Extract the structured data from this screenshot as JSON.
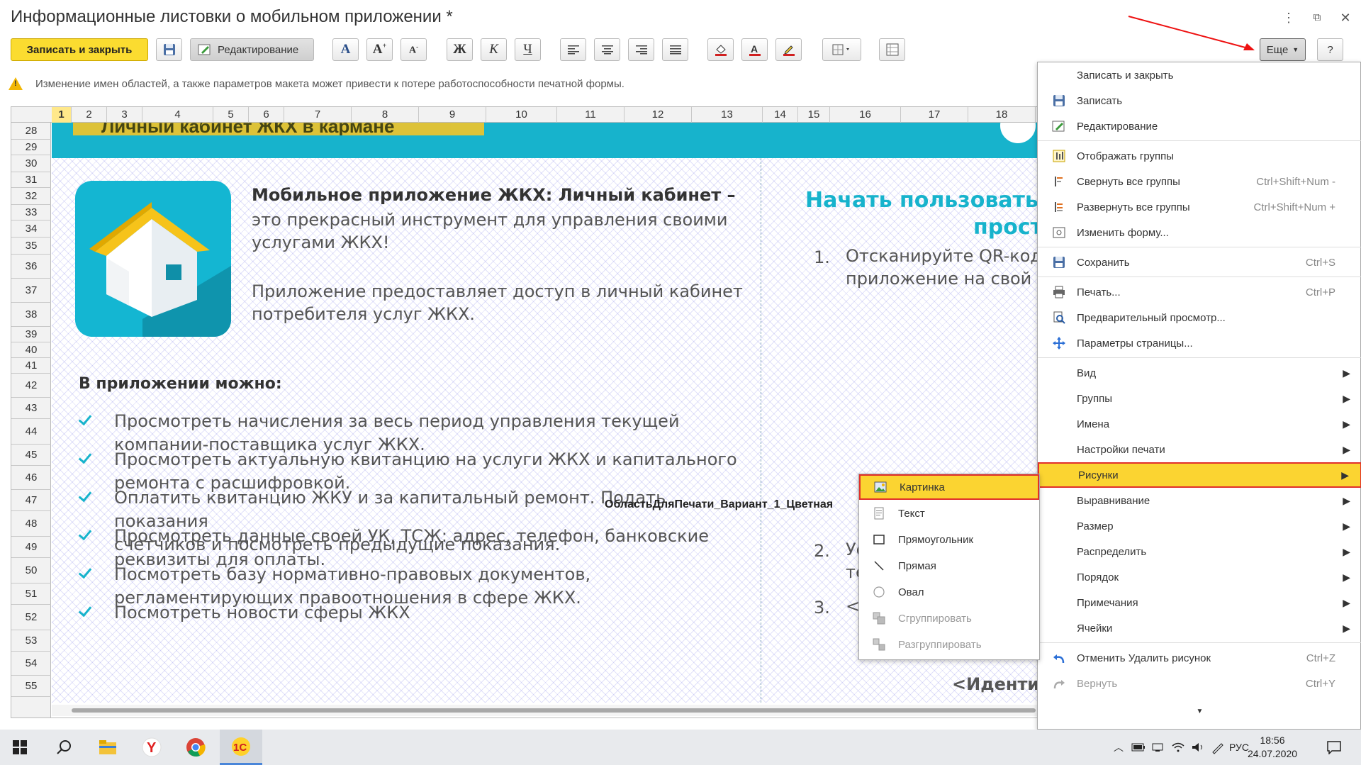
{
  "window": {
    "title": "Информационные листовки о мобильном приложении *"
  },
  "toolbar": {
    "save_close_label": "Записать и закрыть",
    "editing_label": "Редактирование",
    "bold_label": "Ж",
    "italic_label": "К",
    "underline_label": "Ч",
    "more_label": "Еще",
    "help_label": "?"
  },
  "warning": {
    "text": "Изменение имен областей, а также параметров макета может привести к потере работоспособности печатной формы."
  },
  "sheet": {
    "columns": [
      "1",
      "2",
      "3",
      "4",
      "5",
      "6",
      "7",
      "8",
      "9",
      "10",
      "11",
      "12",
      "13",
      "14",
      "15",
      "16",
      "17",
      "18"
    ],
    "rows": [
      "28",
      "29",
      "30",
      "31",
      "32",
      "33",
      "34",
      "35",
      "36",
      "37",
      "38",
      "39",
      "40",
      "41",
      "42",
      "43",
      "44",
      "45",
      "46",
      "47",
      "48",
      "49",
      "50",
      "51",
      "52",
      "53",
      "54",
      "55"
    ]
  },
  "layout": {
    "banner_label": "Личный кабинет ЖКХ в кармане",
    "intro_title": "Мобильное приложение ЖКХ: Личный кабинет –",
    "intro_lines": [
      "это прекрасный инструмент для управления своими",
      "услугами ЖКХ!"
    ],
    "intro_desc_lines": [
      "Приложение предоставляет доступ в личный кабинет",
      "потребителя услуг ЖКХ."
    ],
    "features_title": "В приложении можно:",
    "features": [
      [
        "Просмотреть начисления за весь период управления текущей",
        "компании-поставщика услуг ЖКХ."
      ],
      [
        "Просмотреть актуальную квитанцию на услуги ЖКХ и капитального",
        "ремонта с расшифровкой."
      ],
      [
        "Оплатить квитанцию ЖКУ и за капитальный ремонт. Подать показания",
        "счетчиков и посмотреть предыдущие показания."
      ],
      [
        "Просмотреть данные своей УК, ТСЖ: адрес, телефон, банковские",
        "реквизиты для оплаты."
      ],
      [
        "Посмотреть базу нормативно-правовых документов,",
        "регламентирующих правоотношения в сфере ЖКХ."
      ],
      [
        "Посмотреть новости сферы ЖКХ"
      ]
    ],
    "area_name": "ОбластьДляПечати_Вариант_1_Цветная",
    "right_title_1": "Начать пользоваться",
    "right_title_2": "прост",
    "steps": [
      {
        "num": "1.",
        "lines": [
          "Отсканируйте QR-код,",
          "приложение на свой м"
        ]
      },
      {
        "num": "2.",
        "lines": [
          "Ус",
          "те"
        ]
      },
      {
        "num": "3.",
        "lines": [
          "<Те"
        ]
      }
    ],
    "identifier": "<Идентиф"
  },
  "menu": {
    "items": [
      {
        "label": "Записать и закрыть",
        "shortcut": "",
        "icon": "none",
        "submenu": false
      },
      {
        "label": "Записать",
        "shortcut": "",
        "icon": "floppy-icon",
        "submenu": false
      },
      {
        "label": "Редактирование",
        "shortcut": "",
        "icon": "edit-icon",
        "submenu": false
      },
      {
        "label": "Отображать группы",
        "shortcut": "",
        "icon": "groups-icon",
        "submenu": false
      },
      {
        "label": "Свернуть все группы",
        "shortcut": "Ctrl+Shift+Num -",
        "icon": "collapse-icon",
        "submenu": false
      },
      {
        "label": "Развернуть все группы",
        "shortcut": "Ctrl+Shift+Num +",
        "icon": "expand-icon",
        "submenu": false
      },
      {
        "label": "Изменить форму...",
        "shortcut": "",
        "icon": "form-icon",
        "submenu": false
      },
      {
        "label": "Сохранить",
        "shortcut": "Ctrl+S",
        "icon": "floppy-icon",
        "submenu": false
      },
      {
        "label": "Печать...",
        "shortcut": "Ctrl+P",
        "icon": "printer-icon",
        "submenu": false
      },
      {
        "label": "Предварительный просмотр...",
        "shortcut": "",
        "icon": "preview-icon",
        "submenu": false
      },
      {
        "label": "Параметры страницы...",
        "shortcut": "",
        "icon": "page-params-icon",
        "submenu": false
      },
      {
        "label": "Вид",
        "shortcut": "",
        "icon": "none",
        "submenu": true
      },
      {
        "label": "Группы",
        "shortcut": "",
        "icon": "none",
        "submenu": true
      },
      {
        "label": "Имена",
        "shortcut": "",
        "icon": "none",
        "submenu": true
      },
      {
        "label": "Настройки печати",
        "shortcut": "",
        "icon": "none",
        "submenu": true
      },
      {
        "label": "Рисунки",
        "shortcut": "",
        "icon": "none",
        "submenu": true
      },
      {
        "label": "Выравнивание",
        "shortcut": "",
        "icon": "none",
        "submenu": true
      },
      {
        "label": "Размер",
        "shortcut": "",
        "icon": "none",
        "submenu": true
      },
      {
        "label": "Распределить",
        "shortcut": "",
        "icon": "none",
        "submenu": true
      },
      {
        "label": "Порядок",
        "shortcut": "",
        "icon": "none",
        "submenu": true
      },
      {
        "label": "Примечания",
        "shortcut": "",
        "icon": "none",
        "submenu": true
      },
      {
        "label": "Ячейки",
        "shortcut": "",
        "icon": "none",
        "submenu": true
      },
      {
        "label": "Отменить Удалить рисунок",
        "shortcut": "Ctrl+Z",
        "icon": "undo-icon",
        "submenu": false
      },
      {
        "label": "Вернуть",
        "shortcut": "Ctrl+Y",
        "icon": "redo-icon",
        "submenu": false
      }
    ],
    "highlighted": "Рисунки"
  },
  "submenu": {
    "items": [
      {
        "label": "Картинка",
        "icon": "picture-icon",
        "disabled": false
      },
      {
        "label": "Текст",
        "icon": "text-icon",
        "disabled": false
      },
      {
        "label": "Прямоугольник",
        "icon": "rectangle-icon",
        "disabled": false
      },
      {
        "label": "Прямая",
        "icon": "line-icon",
        "disabled": false
      },
      {
        "label": "Овал",
        "icon": "oval-icon",
        "disabled": false
      },
      {
        "label": "Сгруппировать",
        "icon": "group-icon",
        "disabled": true
      },
      {
        "label": "Разгруппировать",
        "icon": "ungroup-icon",
        "disabled": true
      }
    ],
    "highlighted": "Картинка"
  },
  "taskbar": {
    "language": "РУС",
    "time": "18:56",
    "date": "24.07.2020",
    "apps": [
      "windows-start-icon",
      "search-icon",
      "file-explorer-icon",
      "yandex-browser-icon",
      "chrome-icon",
      "1c-icon"
    ]
  },
  "colors": {
    "accent": "#fbd431",
    "highlight_border": "#e1302b",
    "teal": "#17b3cc"
  }
}
